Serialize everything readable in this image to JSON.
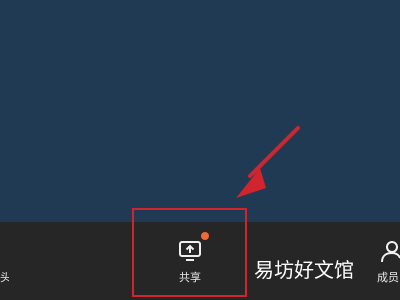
{
  "toolbar": {
    "left_item_label": "头",
    "share": {
      "label": "共享",
      "icon": "screen-share-icon",
      "badge_color": "#f06a35"
    },
    "members": {
      "label": "成员",
      "icon": "members-icon"
    }
  },
  "watermark": {
    "text": "易坊好文馆"
  },
  "colors": {
    "video_background": "#1f3a52",
    "toolbar_background": "#262626",
    "annotation": "#d1242e"
  }
}
